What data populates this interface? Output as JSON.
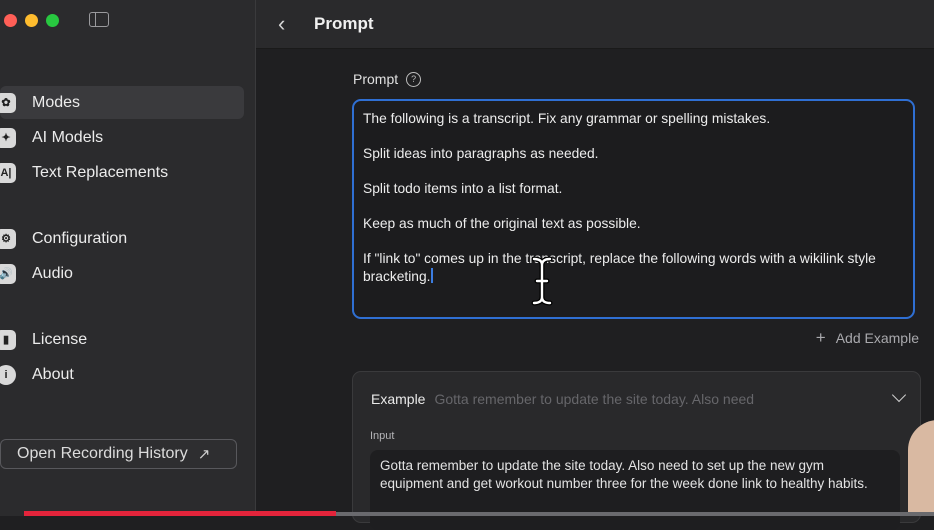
{
  "sidebar": {
    "items": [
      {
        "label": "Modes",
        "icon": "modes-icon",
        "glyph": "✿",
        "active": true
      },
      {
        "label": "AI Models",
        "icon": "sparkle-icon",
        "glyph": "✦"
      },
      {
        "label": "Text Replacements",
        "icon": "text-replace-icon",
        "glyph": "A|"
      },
      {
        "label": "Configuration",
        "icon": "gear-icon",
        "glyph": "⚙"
      },
      {
        "label": "Audio",
        "icon": "speaker-icon",
        "glyph": "🔊"
      },
      {
        "label": "License",
        "icon": "license-icon",
        "glyph": "▮"
      },
      {
        "label": "About",
        "icon": "info-icon",
        "glyph": "i"
      }
    ],
    "history_button": "Open Recording History"
  },
  "header": {
    "title": "Prompt"
  },
  "prompt": {
    "label": "Prompt",
    "paragraphs": [
      "The following is a transcript. Fix any grammar or spelling mistakes.",
      "Split ideas into paragraphs as needed.",
      "Split todo items into a list format.",
      "Keep as much of the original text as possible.",
      "If \"link to\" comes up in the transcript, replace the following words with a wikilink style bracketing."
    ]
  },
  "add_example": "Add Example",
  "example": {
    "title": "Example",
    "preview": "Gotta remember to update the site today. Also need",
    "input_label": "Input",
    "input_text": "Gotta remember to update the site today. Also need to set up the new gym equipment and get workout number three for the week done link to healthy habits."
  },
  "colors": {
    "accent": "#2f6fd3",
    "progress": "#e3243b"
  }
}
